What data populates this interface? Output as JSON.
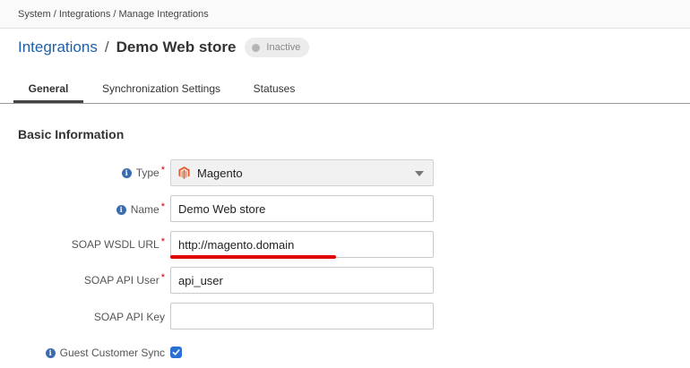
{
  "breadcrumb": "System / Integrations / Manage Integrations",
  "title": {
    "link": "Integrations",
    "separator": "/",
    "name": "Demo Web store",
    "status": "Inactive"
  },
  "tabs": [
    {
      "label": "General",
      "active": true
    },
    {
      "label": "Synchronization Settings",
      "active": false
    },
    {
      "label": "Statuses",
      "active": false
    }
  ],
  "section": {
    "title": "Basic Information"
  },
  "form": {
    "type": {
      "label": "Type",
      "value": "Magento",
      "required": "*"
    },
    "name": {
      "label": "Name",
      "value": "Demo Web store",
      "required": "*"
    },
    "wsdl": {
      "label": "SOAP WSDL URL",
      "value": "http://magento.domain",
      "required": "*"
    },
    "api_user": {
      "label": "SOAP API User",
      "value": "api_user",
      "required": "*"
    },
    "api_key": {
      "label": "SOAP API Key",
      "value": ""
    },
    "guest_sync": {
      "label": "Guest Customer Sync",
      "checked": true
    }
  },
  "colors": {
    "link": "#1e5fa8",
    "checkbox": "#2a6fd6",
    "required": "#cc0000",
    "highlight": "#e00000"
  },
  "icons": {
    "info": "info-icon",
    "type_option": "magento-logo-icon",
    "dropdown": "chevron-down-icon"
  }
}
